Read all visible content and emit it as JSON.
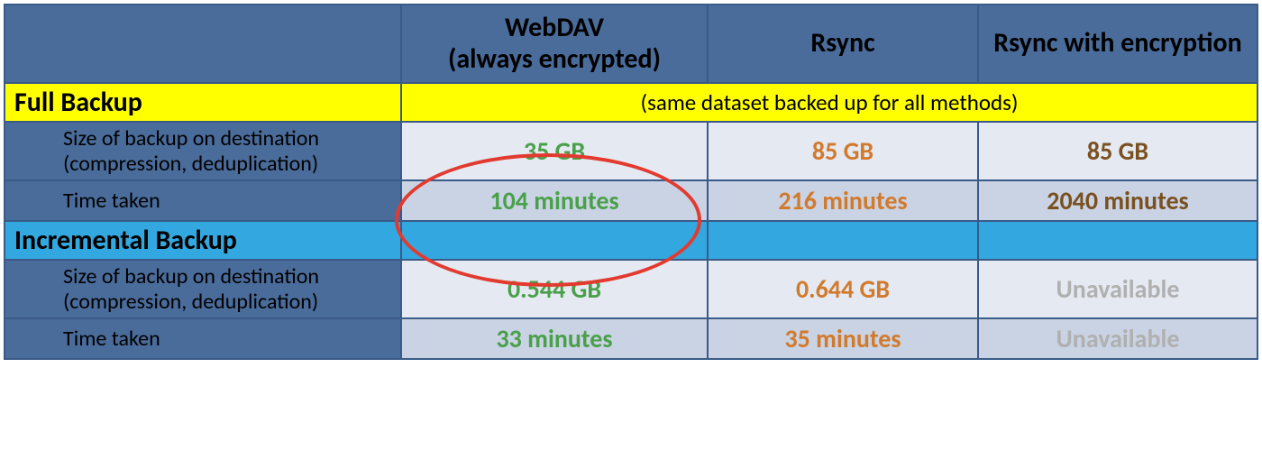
{
  "columns": {
    "col1": "WebDAV\n(always encrypted)",
    "col2": "Rsync",
    "col3": "Rsync with encryption"
  },
  "sections": {
    "full": {
      "title": "Full Backup",
      "note": "(same dataset backed up for all methods)"
    },
    "incremental": {
      "title": "Incremental Backup"
    }
  },
  "metrics": {
    "size_label": "Size of backup on destination (compression, deduplication)",
    "time_label": "Time taken"
  },
  "full": {
    "size": {
      "webdav": "35 GB",
      "rsync": "85 GB",
      "rsync_enc": "85 GB"
    },
    "time": {
      "webdav": "104 minutes",
      "rsync": "216 minutes",
      "rsync_enc": "2040 minutes"
    }
  },
  "incremental": {
    "size": {
      "webdav": "0.544 GB",
      "rsync": "0.644 GB",
      "rsync_enc": "Unavailable"
    },
    "time": {
      "webdav": "33 minutes",
      "rsync": "35 minutes",
      "rsync_enc": "Unavailable"
    }
  },
  "chart_data": {
    "type": "table",
    "title": "Backup method comparison",
    "columns": [
      "WebDAV (always encrypted)",
      "Rsync",
      "Rsync with encryption"
    ],
    "sections": [
      {
        "name": "Full Backup",
        "note": "(same dataset backed up for all methods)",
        "rows": [
          {
            "metric": "Size of backup on destination (compression, deduplication)",
            "unit": "GB",
            "values": [
              35,
              85,
              85
            ]
          },
          {
            "metric": "Time taken",
            "unit": "minutes",
            "values": [
              104,
              216,
              2040
            ]
          }
        ]
      },
      {
        "name": "Incremental Backup",
        "rows": [
          {
            "metric": "Size of backup on destination (compression, deduplication)",
            "unit": "GB",
            "values": [
              0.544,
              0.644,
              null
            ]
          },
          {
            "metric": "Time taken",
            "unit": "minutes",
            "values": [
              33,
              35,
              null
            ]
          }
        ]
      }
    ],
    "highlight": {
      "section": "Full Backup",
      "column": "WebDAV (always encrypted)"
    }
  }
}
